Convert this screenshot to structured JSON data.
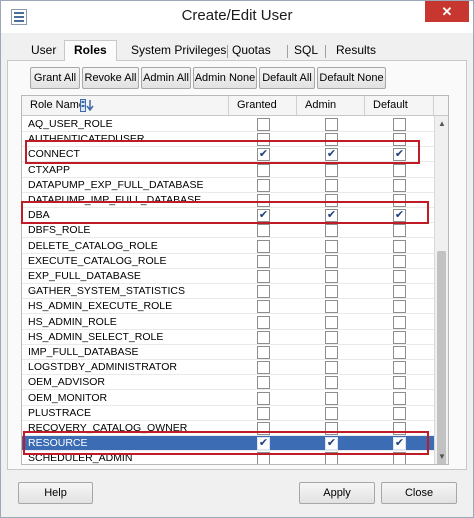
{
  "window": {
    "title": "Create/Edit User",
    "close_glyph": "✕"
  },
  "tabs": [
    {
      "label": "User"
    },
    {
      "label": "Roles"
    },
    {
      "label": "System Privileges"
    },
    {
      "label": "Quotas"
    },
    {
      "label": "SQL"
    },
    {
      "label": "Results"
    }
  ],
  "toolbar": {
    "grant_all": "Grant All",
    "revoke_all": "Revoke All",
    "admin_all": "Admin All",
    "admin_none": "Admin None",
    "default_all": "Default All",
    "default_none": "Default None"
  },
  "grid": {
    "columns": {
      "role_name": "Role Name",
      "granted": "Granted",
      "admin": "Admin",
      "default": "Default"
    },
    "rows": [
      {
        "name": "AQ_USER_ROLE",
        "granted": false,
        "admin": false,
        "default": false
      },
      {
        "name": "AUTHENTICATEDUSER",
        "granted": false,
        "admin": false,
        "default": false
      },
      {
        "name": "CONNECT",
        "granted": true,
        "admin": true,
        "default": true
      },
      {
        "name": "CTXAPP",
        "granted": false,
        "admin": false,
        "default": false
      },
      {
        "name": "DATAPUMP_EXP_FULL_DATABASE",
        "granted": false,
        "admin": false,
        "default": false
      },
      {
        "name": "DATAPUMP_IMP_FULL_DATABASE",
        "granted": false,
        "admin": false,
        "default": false
      },
      {
        "name": "DBA",
        "granted": true,
        "admin": true,
        "default": true
      },
      {
        "name": "DBFS_ROLE",
        "granted": false,
        "admin": false,
        "default": false
      },
      {
        "name": "DELETE_CATALOG_ROLE",
        "granted": false,
        "admin": false,
        "default": false
      },
      {
        "name": "EXECUTE_CATALOG_ROLE",
        "granted": false,
        "admin": false,
        "default": false
      },
      {
        "name": "EXP_FULL_DATABASE",
        "granted": false,
        "admin": false,
        "default": false
      },
      {
        "name": "GATHER_SYSTEM_STATISTICS",
        "granted": false,
        "admin": false,
        "default": false
      },
      {
        "name": "HS_ADMIN_EXECUTE_ROLE",
        "granted": false,
        "admin": false,
        "default": false
      },
      {
        "name": "HS_ADMIN_ROLE",
        "granted": false,
        "admin": false,
        "default": false
      },
      {
        "name": "HS_ADMIN_SELECT_ROLE",
        "granted": false,
        "admin": false,
        "default": false
      },
      {
        "name": "IMP_FULL_DATABASE",
        "granted": false,
        "admin": false,
        "default": false
      },
      {
        "name": "LOGSTDBY_ADMINISTRATOR",
        "granted": false,
        "admin": false,
        "default": false
      },
      {
        "name": "OEM_ADVISOR",
        "granted": false,
        "admin": false,
        "default": false
      },
      {
        "name": "OEM_MONITOR",
        "granted": false,
        "admin": false,
        "default": false
      },
      {
        "name": "PLUSTRACE",
        "granted": false,
        "admin": false,
        "default": false
      },
      {
        "name": "RECOVERY_CATALOG_OWNER",
        "granted": false,
        "admin": false,
        "default": false
      },
      {
        "name": "RESOURCE",
        "granted": true,
        "admin": true,
        "default": true,
        "selected": true
      },
      {
        "name": "SCHEDULER_ADMIN",
        "granted": false,
        "admin": false,
        "default": false
      }
    ]
  },
  "footer": {
    "help": "Help",
    "apply": "Apply",
    "close": "Close"
  },
  "colors": {
    "highlight_box": "#c01c28",
    "selected_row": "#3c6cb4",
    "close_button": "#c7372f"
  },
  "icons": {
    "window": "app-window-icon",
    "sort": "sort-icon",
    "check": "checkmark-icon"
  }
}
